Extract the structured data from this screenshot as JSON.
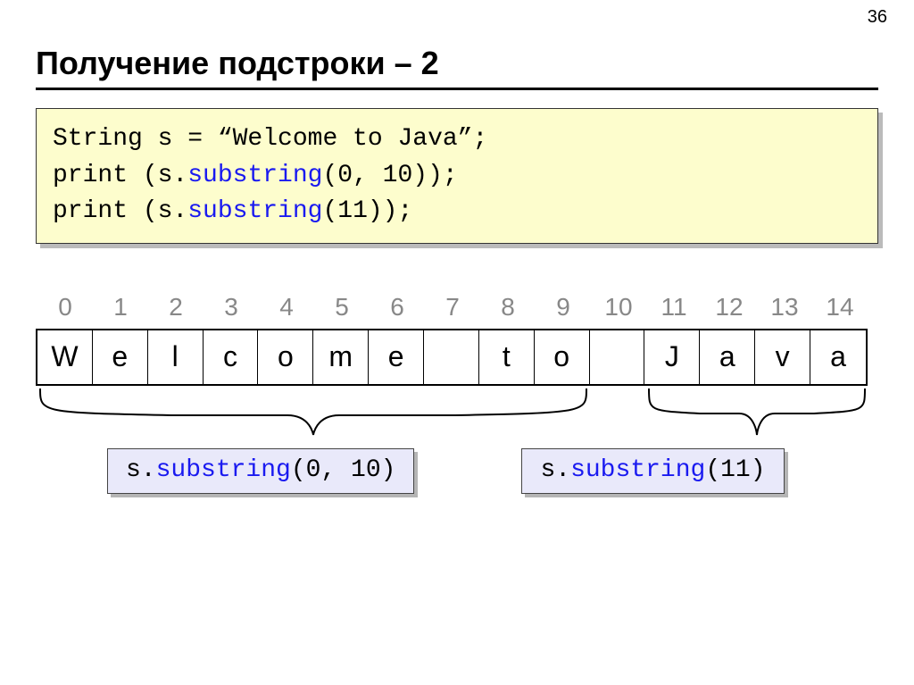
{
  "page_number": "36",
  "title": "Получение подстроки – 2",
  "code": {
    "line1_pre": "String s = “Welcome to Java”;",
    "line2_pre": "print (s.",
    "line2_fn": "substring",
    "line2_post": "(0, 10));",
    "line3_pre": "print (s.",
    "line3_fn": "substring",
    "line3_post": "(11));"
  },
  "indices": [
    "0",
    "1",
    "2",
    "3",
    "4",
    "5",
    "6",
    "7",
    "8",
    "9",
    "10",
    "11",
    "12",
    "13",
    "14"
  ],
  "chars": [
    "W",
    "e",
    "l",
    "c",
    "o",
    "m",
    "e",
    " ",
    "t",
    "o",
    " ",
    "J",
    "a",
    "v",
    "a"
  ],
  "sub_a_pre": "s.",
  "sub_a_fn": "substring",
  "sub_a_post": "(0, 10)",
  "sub_b_pre": "s.",
  "sub_b_fn": "substring",
  "sub_b_post": "(11)",
  "chart_data": {
    "type": "table",
    "string_value": "Welcome to Java",
    "index_range": [
      0,
      14
    ],
    "substrings": [
      {
        "call": "s.substring(0, 10)",
        "range": [
          0,
          9
        ],
        "result": "Welcome to"
      },
      {
        "call": "s.substring(11)",
        "range": [
          11,
          14
        ],
        "result": "Java"
      }
    ]
  }
}
